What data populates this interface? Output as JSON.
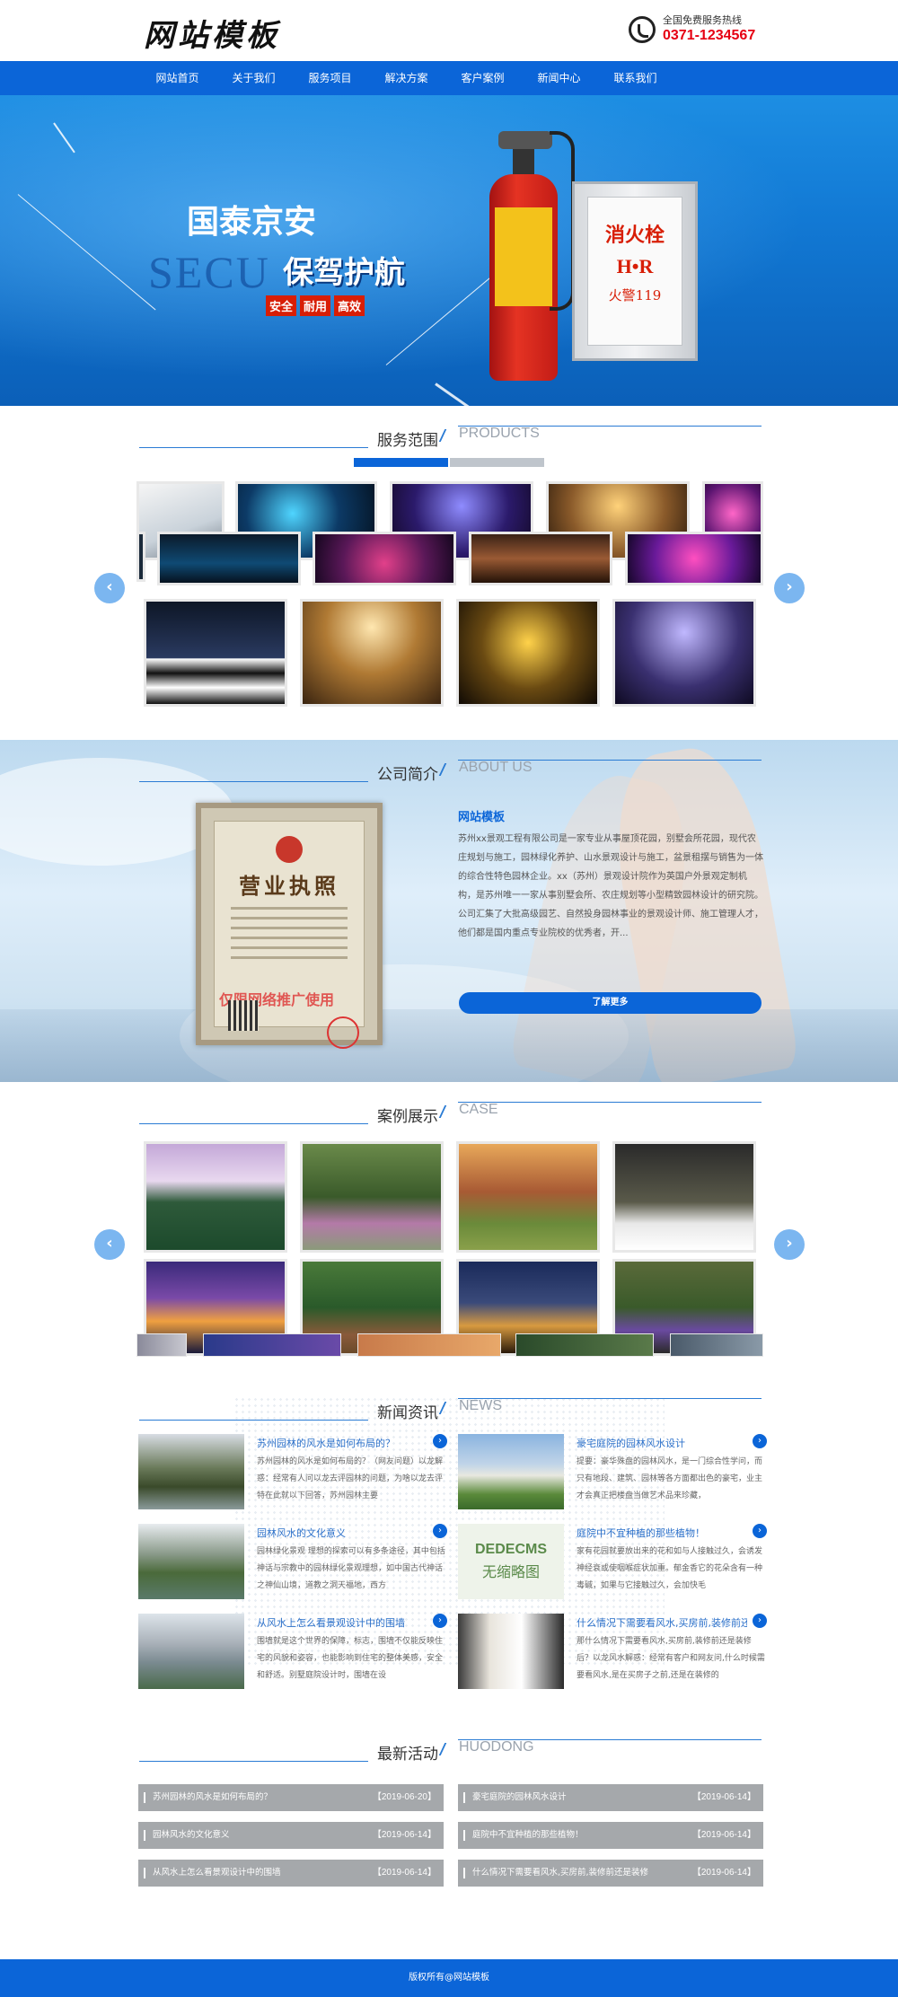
{
  "header": {
    "logo": "网站模板",
    "hotline_label": "全国免费服务热线",
    "hotline_number": "0371-1234567"
  },
  "nav": {
    "items": [
      "网站首页",
      "关于我们",
      "服务项目",
      "解决方案",
      "客户案例",
      "新闻中心",
      "联系我们"
    ]
  },
  "banner": {
    "title1": "国泰京安",
    "ghost": "SECU",
    "title2": "保驾护航",
    "tags": [
      "安全",
      "耐用",
      "高效"
    ],
    "cabinet_title": "消火栓",
    "cabinet_hr": "H•R",
    "cabinet_sub": "火警119"
  },
  "products": {
    "title_cn": "服务范围",
    "title_en": "PRODUCTS"
  },
  "about": {
    "title_cn": "公司简介",
    "title_en": "ABOUT US",
    "cert_title": "营业执照",
    "cert_watermark": "仅限网络推广使用",
    "heading": "网站模板",
    "text": "苏州xx景观工程有限公司是一家专业从事屋顶花园，别墅会所花园，现代农庄规划与施工，园林绿化养护、山水景观设计与施工，盆景租摆与销售为一体的综合性特色园林企业。xx（苏州）景观设计院作为英国户外景观定制机构，是苏州唯一一家从事别墅会所、农庄规划等小型精致园林设计的研究院。公司汇集了大批高级园艺、自然投身园林事业的景观设计师、施工管理人才，他们都是国内重点专业院校的优秀者，开...",
    "button": "了解更多"
  },
  "case": {
    "title_cn": "案例展示",
    "title_en": "CASE"
  },
  "news": {
    "title_cn": "新闻资讯",
    "title_en": "NEWS",
    "placeholder_cn": "DEDECMS",
    "placeholder_sub": "无缩略图",
    "items": [
      {
        "title": "苏州园林的风水是如何布局的？",
        "desc": "苏州园林的风水是如何布局的？（网友问题）以龙解惑：经常有人问以龙去评园林的问题，为啥以龙去评特在此就以下回答，苏州园林主要"
      },
      {
        "title": "豪宅庭院的园林风水设计",
        "desc": "提要：豪华殊盘的园林风水，是一门综合性学问，而只有地段、建筑、园林等各方面都出色的豪宅，业主才会真正把楼盘当做艺术品来珍藏，"
      },
      {
        "title": "园林风水的文化意义",
        "desc": "园林绿化景观 理想的探索可以有多条途径，其中包括神话与宗教中的园林绿化景观理想，如中国古代神话之神仙山境，道教之洞天福地，西方"
      },
      {
        "title": "庭院中不宜种植的那些植物！",
        "desc": "家有花园就要放出来的花和如与人接触过久，会诱发神经衰或使咽喉症状加重。郁金香它的花朵含有一种毒碱，如果与它接触过久，会加快毛"
      },
      {
        "title": "从风水上怎么看景观设计中的围墙",
        "desc": "围墙就是这个世界的保障，标志，围墙不仅能反映住宅的风貌和姿容，也能影响到住宅的整体美感，安全和舒适。别墅庭院设计时，围墙在设"
      },
      {
        "title": "什么情况下需要看风水,买房前,装修前还...",
        "desc": "那什么情况下需要看风水,买房前,装修前还是装修后？以龙风水解惑：经常有客户和网友问,什么时候需要看风水,是在买房子之前,还是在装修的"
      }
    ]
  },
  "activities": {
    "title_cn": "最新活动",
    "title_en": "HUODONG",
    "rows": [
      {
        "title": "苏州园林的风水是如何布局的？",
        "date": "【2019-06-20】"
      },
      {
        "title": "豪宅庭院的园林风水设计",
        "date": "【2019-06-14】"
      },
      {
        "title": "园林风水的文化意义",
        "date": "【2019-06-14】"
      },
      {
        "title": "庭院中不宜种植的那些植物！",
        "date": "【2019-06-14】"
      },
      {
        "title": "从风水上怎么看景观设计中的围墙",
        "date": "【2019-06-14】"
      },
      {
        "title": "什么情况下需要看风水,买房前,装修前还是装修",
        "date": "【2019-06-14】"
      }
    ]
  },
  "footer": {
    "copyright": "版权所有@网站模板"
  },
  "colors": {
    "brand": "#0b65d8",
    "hotline": "#e60012",
    "activity_bar": "#a5a8ab"
  }
}
